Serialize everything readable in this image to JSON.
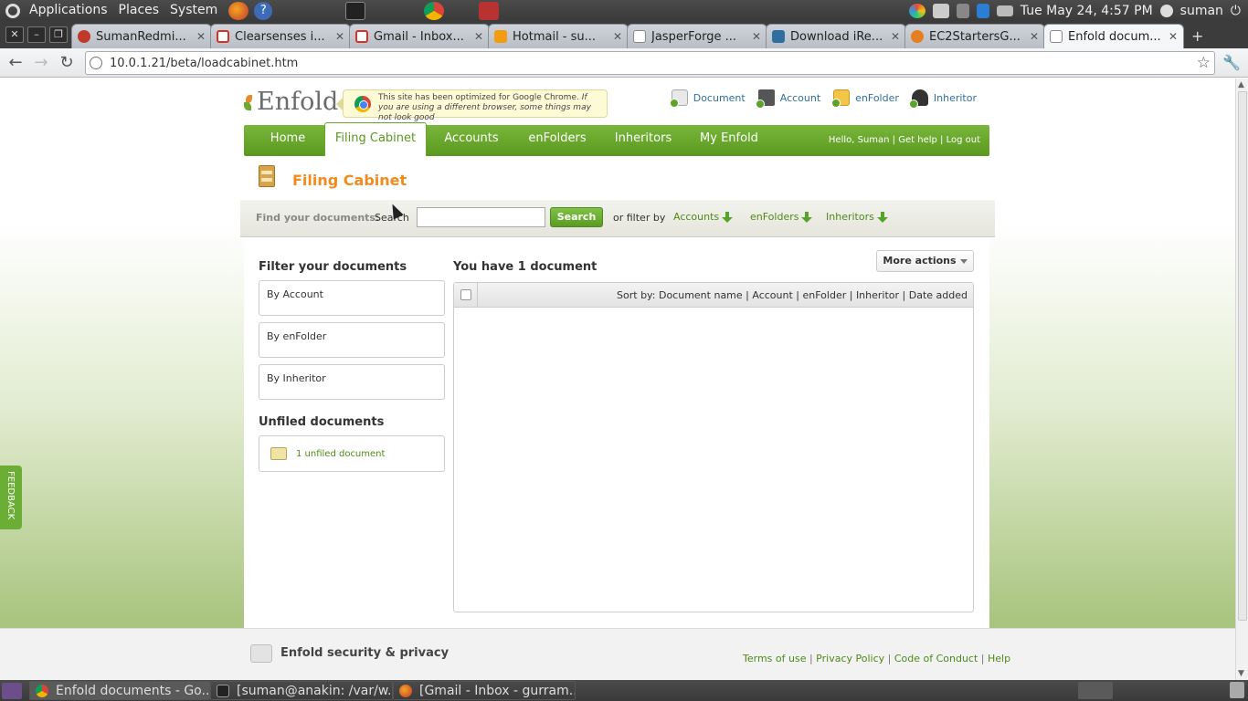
{
  "top_panel": {
    "menus": [
      "Applications",
      "Places",
      "System"
    ],
    "datetime": "Tue May 24,  4:57 PM",
    "user": "suman"
  },
  "browser": {
    "tabs": [
      {
        "title": "SumanRedmi...",
        "favicon_color": "#c0392b"
      },
      {
        "title": "Clearsenses i...",
        "favicon_color": "#d93025"
      },
      {
        "title": "Gmail - Inbox...",
        "favicon_color": "#d93025"
      },
      {
        "title": "Hotmail - su...",
        "favicon_color": "#f39c12"
      },
      {
        "title": "JasperForge ...",
        "favicon_color": "#ffffff"
      },
      {
        "title": "Download iRe...",
        "favicon_color": "#2f6f9f"
      },
      {
        "title": "EC2StartersG...",
        "favicon_color": "#e67e22"
      },
      {
        "title": "Enfold docum...",
        "favicon_color": "#ffffff"
      }
    ],
    "url": "10.0.1.21/beta/loadcabinet.htm"
  },
  "site": {
    "logo": "Enfold",
    "notice": {
      "main": "This site has been optimized for Google Chrome.",
      "italic": " If you are using a different browser, some things may not look good"
    },
    "quick_add": [
      "Document",
      "Account",
      "enFolder",
      "Inheritor"
    ],
    "nav_tabs": [
      "Home",
      "Filing Cabinet",
      "Accounts",
      "enFolders",
      "Inheritors",
      "My Enfold"
    ],
    "user_nav": "Hello, Suman |  Get help  |  Log out",
    "page_title": "Filing Cabinet",
    "search": {
      "find_label": "Find your documents:",
      "search_label": "Search",
      "input_value": "",
      "button": "Search",
      "filter_by": "or filter by",
      "filters": [
        "Accounts",
        "enFolders",
        "Inheritors"
      ]
    },
    "filter_panel": {
      "heading": "Filter your documents",
      "options": [
        "By Account",
        "By enFolder",
        "By Inheritor"
      ],
      "unfiled_heading": "Unfiled documents",
      "unfiled_link": "1 unfiled document"
    },
    "documents": {
      "count_text": "You have 1 document",
      "more_actions": "More actions",
      "sort_label": "Sort by:",
      "sort_options": [
        "Document name",
        "Account",
        "enFolder",
        "Inheritor",
        "Date added"
      ]
    },
    "footer": {
      "title": "Enfold security & privacy",
      "links": [
        "Terms of use",
        "Privacy Policy",
        "Code of Conduct",
        "Help"
      ]
    },
    "feedback": "FEEDBACK"
  },
  "taskbar": {
    "tasks": [
      "Enfold documents - Go...",
      "[suman@anakin: /var/w...",
      "[Gmail - Inbox - gurram..."
    ]
  }
}
